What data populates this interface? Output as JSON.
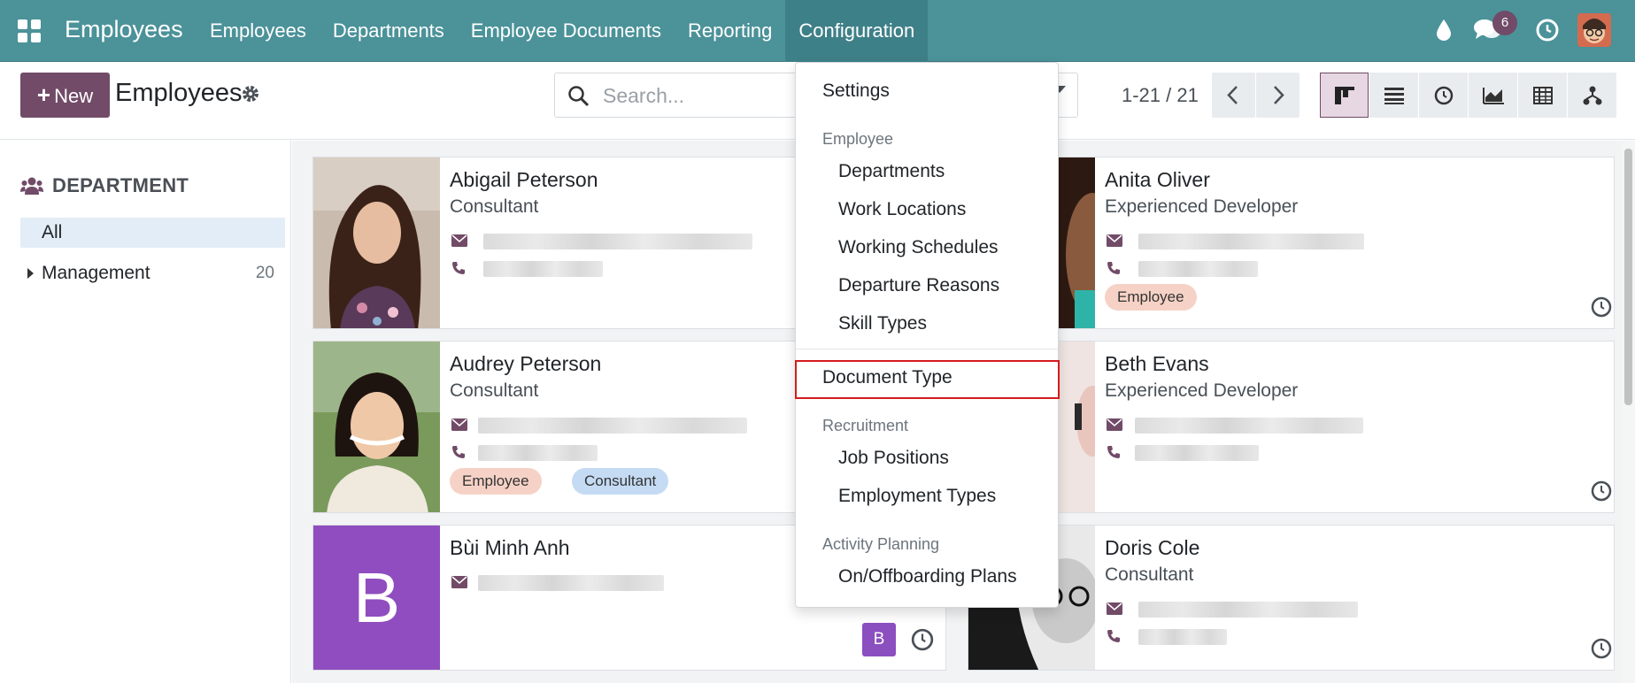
{
  "navbar": {
    "brand": "Employees",
    "menu": [
      {
        "label": "Employees"
      },
      {
        "label": "Departments"
      },
      {
        "label": "Employee Documents"
      },
      {
        "label": "Reporting"
      },
      {
        "label": "Configuration"
      }
    ],
    "messages_count": "6",
    "icons": [
      "apps-grid-icon",
      "droplet-icon",
      "chat-icon",
      "clock-icon",
      "user-avatar"
    ]
  },
  "control_panel": {
    "new_label": "New",
    "title": "Employees",
    "search_placeholder": "Search...",
    "pager": "1-21 / 21",
    "views": [
      "kanban-view-icon",
      "list-view-icon",
      "activity-view-icon",
      "graph-view-icon",
      "pivot-view-icon",
      "hierarchy-view-icon"
    ]
  },
  "sidebar": {
    "header": "DEPARTMENT",
    "items": [
      {
        "label": "All",
        "count": ""
      },
      {
        "label": "Management",
        "count": "20"
      }
    ]
  },
  "cards": [
    {
      "name": "Abigail Peterson",
      "job": "Consultant",
      "tags": []
    },
    {
      "name": "Anita Oliver",
      "job": "Experienced Developer",
      "tags": [
        "Employee"
      ]
    },
    {
      "name": "Audrey Peterson",
      "job": "Consultant",
      "tags": [
        "Employee",
        "Consultant"
      ]
    },
    {
      "name": "Beth Evans",
      "job": "Experienced Developer",
      "tags": []
    },
    {
      "name": "Bùi Minh Anh",
      "job": "",
      "initial": "B",
      "tags": []
    },
    {
      "name": "Doris Cole",
      "job": "Consultant",
      "tags": []
    }
  ],
  "config_menu": {
    "settings": "Settings",
    "employee_header": "Employee",
    "employee_items": [
      "Departments",
      "Work Locations",
      "Working Schedules",
      "Departure Reasons",
      "Skill Types"
    ],
    "document_type": "Document Type",
    "recruitment_header": "Recruitment",
    "recruitment_items": [
      "Job Positions",
      "Employment Types"
    ],
    "activity_header": "Activity Planning",
    "activity_items": [
      "On/Offboarding Plans"
    ]
  },
  "colors": {
    "navbar": "#4b9299",
    "primary": "#714b67",
    "highlight": "#d41c1c",
    "tag_employee": "#f6d2c6",
    "tag_consultant": "#c5dbf4"
  }
}
